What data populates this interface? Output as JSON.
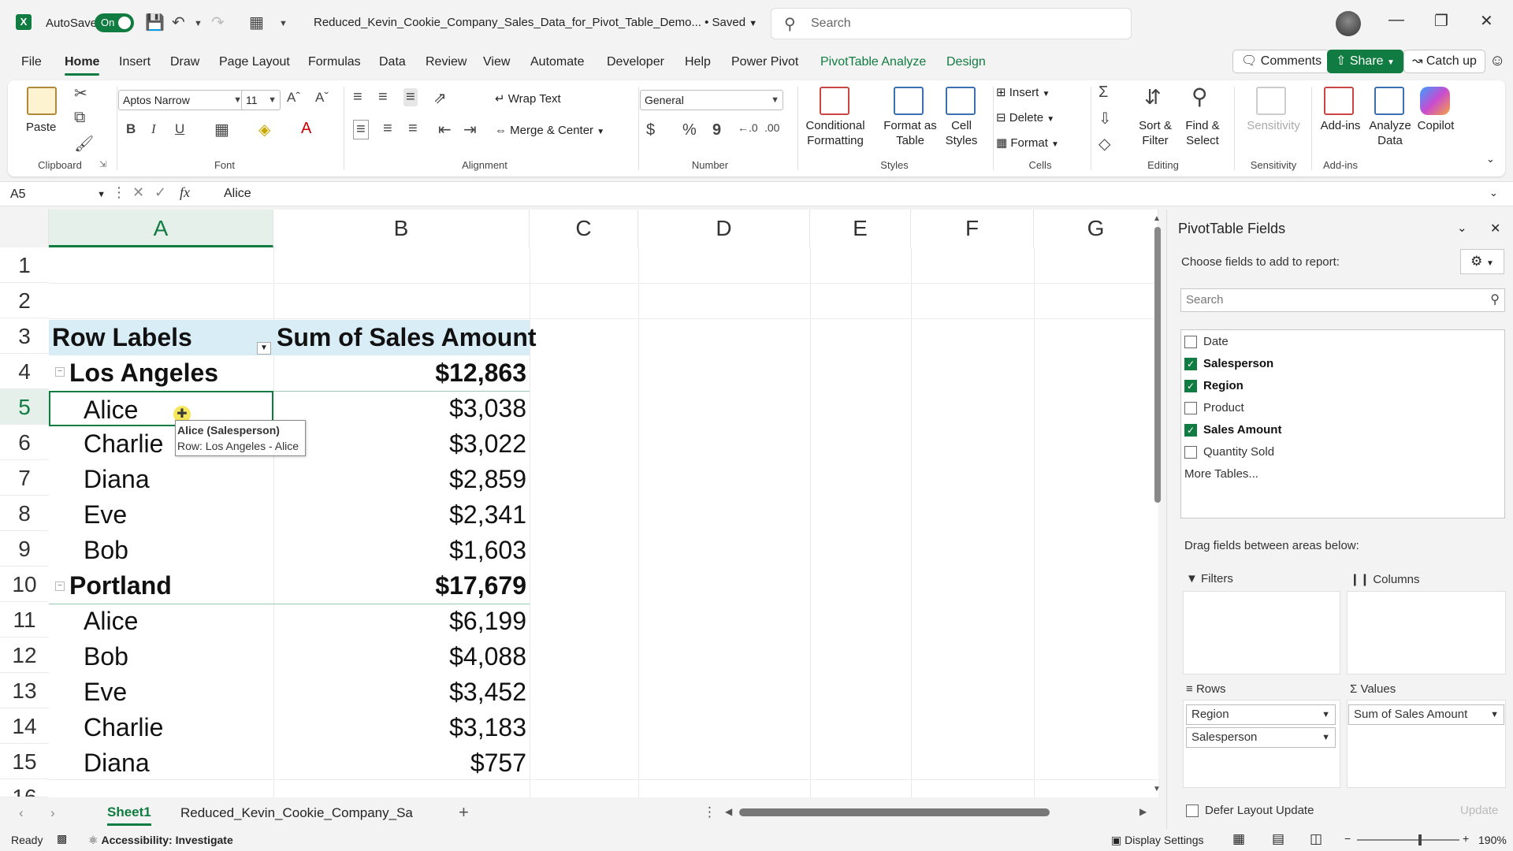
{
  "titlebar": {
    "autosave_label": "AutoSave",
    "autosave_state": "On",
    "doc_title": "Reduced_Kevin_Cookie_Company_Sales_Data_for_Pivot_Table_Demo... • Saved",
    "search_placeholder": "Search"
  },
  "menu": {
    "tabs": [
      "File",
      "Home",
      "Insert",
      "Draw",
      "Page Layout",
      "Formulas",
      "Data",
      "Review",
      "View",
      "Automate",
      "Developer",
      "Help",
      "Power Pivot",
      "PivotTable Analyze",
      "Design"
    ],
    "comments": "Comments",
    "share": "Share",
    "catchup": "Catch up"
  },
  "ribbon": {
    "clipboard": {
      "paste": "Paste",
      "label": "Clipboard"
    },
    "font": {
      "name": "Aptos Narrow",
      "size": "11",
      "label": "Font",
      "bold": "B",
      "italic": "I",
      "underline": "U"
    },
    "alignment": {
      "wrap": "Wrap Text",
      "merge": "Merge & Center",
      "label": "Alignment"
    },
    "number": {
      "format": "General",
      "label": "Number",
      "currency": "$",
      "percent": "%",
      "comma": "9"
    },
    "styles": {
      "conditional": "Conditional Formatting",
      "format_table": "Format as Table",
      "cell_styles": "Cell Styles",
      "label": "Styles"
    },
    "cells": {
      "insert": "Insert",
      "delete": "Delete",
      "format": "Format",
      "label": "Cells"
    },
    "editing": {
      "sort": "Sort & Filter",
      "find": "Find & Select",
      "label": "Editing"
    },
    "sensitivity": {
      "btn": "Sensitivity",
      "label": "Sensitivity"
    },
    "addins": {
      "btn": "Add-ins",
      "analyze": "Analyze Data",
      "copilot": "Copilot",
      "label": "Add-ins"
    }
  },
  "formula_bar": {
    "name_box": "A5",
    "content": "Alice"
  },
  "grid": {
    "columns": [
      "A",
      "B",
      "C",
      "D",
      "E",
      "F",
      "G"
    ],
    "rows": [
      "1",
      "2",
      "3",
      "4",
      "5",
      "6",
      "7",
      "8",
      "9",
      "10",
      "11",
      "12",
      "13",
      "14",
      "15"
    ],
    "header_a": "Row Labels",
    "header_b": "Sum of Sales Amount",
    "pivot_rows": [
      {
        "label": "Los Angeles",
        "value": "$12,863",
        "group": true
      },
      {
        "label": "Alice",
        "value": "$3,038",
        "group": false
      },
      {
        "label": "Charlie",
        "value": "$3,022",
        "group": false
      },
      {
        "label": "Diana",
        "value": "$2,859",
        "group": false
      },
      {
        "label": "Eve",
        "value": "$2,341",
        "group": false
      },
      {
        "label": "Bob",
        "value": "$1,603",
        "group": false
      },
      {
        "label": "Portland",
        "value": "$17,679",
        "group": true
      },
      {
        "label": "Alice",
        "value": "$6,199",
        "group": false
      },
      {
        "label": "Bob",
        "value": "$4,088",
        "group": false
      },
      {
        "label": "Eve",
        "value": "$3,452",
        "group": false
      },
      {
        "label": "Charlie",
        "value": "$3,183",
        "group": false
      },
      {
        "label": "Diana",
        "value": "$757",
        "group": false
      }
    ],
    "tooltip_title": "Alice (Salesperson)",
    "tooltip_row": "Row: Los Angeles - Alice"
  },
  "sheets": {
    "tabs": [
      "Sheet1",
      "Reduced_Kevin_Cookie_Company_Sa"
    ],
    "add": "+"
  },
  "status": {
    "ready": "Ready",
    "accessibility": "Accessibility: Investigate",
    "display": "Display Settings",
    "zoom": "190%"
  },
  "pane": {
    "title": "PivotTable Fields",
    "subtitle": "Choose fields to add to report:",
    "search_placeholder": "Search",
    "fields": [
      {
        "name": "Date",
        "checked": false
      },
      {
        "name": "Salesperson",
        "checked": true
      },
      {
        "name": "Region",
        "checked": true
      },
      {
        "name": "Product",
        "checked": false
      },
      {
        "name": "Sales Amount",
        "checked": true
      },
      {
        "name": "Quantity Sold",
        "checked": false
      }
    ],
    "more_tables": "More Tables...",
    "drag_hint": "Drag fields between areas below:",
    "filters": "Filters",
    "columns": "Columns",
    "rows": "Rows",
    "values": "Values",
    "row_items": [
      "Region",
      "Salesperson"
    ],
    "value_items": [
      "Sum of Sales Amount"
    ],
    "defer": "Defer Layout Update",
    "update": "Update"
  },
  "colors": {
    "accent": "#107c41",
    "pivot_header": "#d9edf7"
  }
}
